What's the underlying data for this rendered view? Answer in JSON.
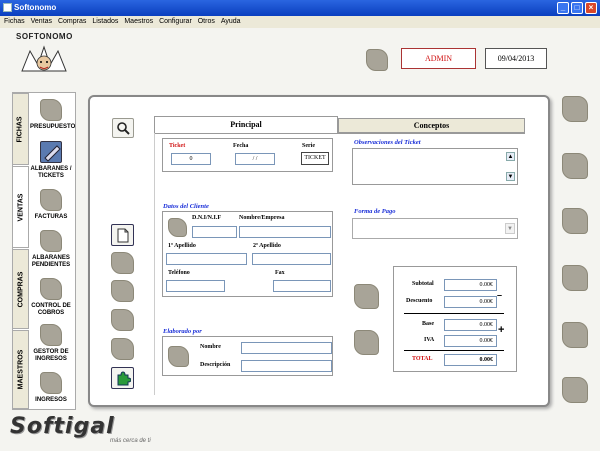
{
  "window": {
    "title": "Softonomo"
  },
  "menu": [
    "Fichas",
    "Ventas",
    "Compras",
    "Listados",
    "Maestros",
    "Configurar",
    "Otros",
    "Ayuda"
  ],
  "logo": {
    "text": "SOFTONOMO"
  },
  "header": {
    "user": "ADMIN",
    "date": "09/04/2013"
  },
  "side_tabs": [
    "FICHAS",
    "VENTAS",
    "COMPRAS",
    "MAESTROS"
  ],
  "side_items": [
    "PRESUPUESTO",
    "ALBARANES / TICKETS",
    "FACTURAS",
    "ALBARANES PENDIENTES",
    "CONTROL DE COBROS",
    "GESTOR DE INGRESOS",
    "INGRESOS"
  ],
  "tabs": {
    "principal": "Principal",
    "conceptos": "Conceptos"
  },
  "ticket": {
    "ticket_label": "Ticket",
    "ticket_value": "0",
    "fecha_label": "Fecha",
    "fecha_value": "/ /",
    "serie_label": "Serie",
    "serie_value": "TICKET"
  },
  "cliente": {
    "title": "Datos del Cliente",
    "dni_label": "D.N.I/N.I.F",
    "nombre_label": "Nombre/Empresa",
    "ap1_label": "1º Apellido",
    "ap2_label": "2º Apellido",
    "tel_label": "Teléfono",
    "fax_label": "Fax"
  },
  "elaborado": {
    "title": "Elaborado por",
    "nombre_label": "Nombre",
    "desc_label": "Descripción"
  },
  "observaciones": {
    "title": "Observaciones del Ticket"
  },
  "forma_pago": {
    "title": "Forma de Pago"
  },
  "totals": {
    "subtotal_label": "Subtotal",
    "subtotal": "0.00€",
    "descuento_label": "Descuento",
    "descuento": "0.00€",
    "base_label": "Base",
    "base": "0.00€",
    "iva_label": "IVA",
    "iva": "0.00€",
    "total_label": "TOTAL",
    "total": "0.00€",
    "minus": "–",
    "plus": "+"
  },
  "footer": {
    "brand": "Softigal",
    "tagline": "más cerca de ti"
  },
  "colors": {
    "title_red": "#d01010",
    "blue_label": "#1a2fd8",
    "titlebar": "#0a3fbf"
  }
}
